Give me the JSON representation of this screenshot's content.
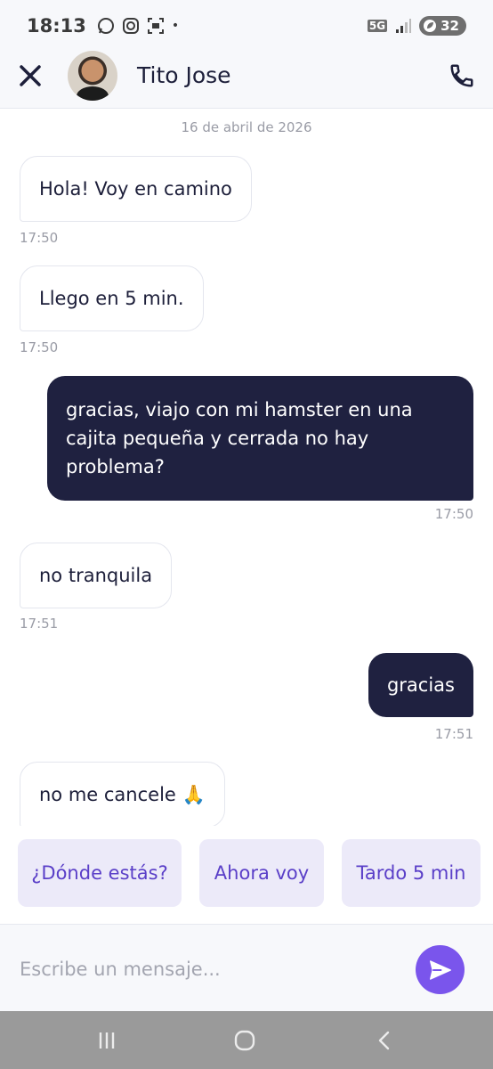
{
  "status_bar": {
    "time": "18:13",
    "network": "5G",
    "battery": "32"
  },
  "header": {
    "contact_name": "Tito Jose"
  },
  "chat": {
    "date": "16 de abril de 2026",
    "messages": [
      {
        "direction": "in",
        "text": "Hola! Voy en camino",
        "time": "17:50"
      },
      {
        "direction": "in",
        "text": "Llego en 5 min.",
        "time": "17:50"
      },
      {
        "direction": "out",
        "text": "gracias, viajo con mi hamster en una cajita pequeña y cerrada  no hay problema?",
        "time": "17:50"
      },
      {
        "direction": "in",
        "text": "no tranquila",
        "time": "17:51"
      },
      {
        "direction": "out",
        "text": "gracias",
        "time": "17:51"
      },
      {
        "direction": "in",
        "text": "no me cancele 🙏",
        "time": ""
      }
    ]
  },
  "quick_replies": [
    "¿Dónde estás?",
    "Ahora voy",
    "Tardo 5 min"
  ],
  "composer": {
    "placeholder": "Escribe un mensaje..."
  },
  "colors": {
    "accent": "#7a55ec",
    "outgoing_bubble": "#1f2140",
    "chip_bg": "#eceaf9",
    "chip_text": "#5a3fc8"
  }
}
